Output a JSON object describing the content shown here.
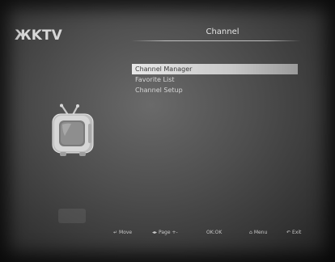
{
  "brand": {
    "logo": "ЖKTV"
  },
  "header": {
    "title": "Channel"
  },
  "menu": {
    "items": [
      {
        "label": "Channel Manager",
        "selected": true
      },
      {
        "label": "Favorite List",
        "selected": false
      },
      {
        "label": "Channel Setup",
        "selected": false
      }
    ]
  },
  "icons": {
    "main": "tv-icon"
  },
  "footer": {
    "hints": [
      {
        "glyph": "↵",
        "label": "Move",
        "icon": "enter-icon"
      },
      {
        "glyph": "◂▸",
        "label": "Page +-",
        "icon": "page-arrows-icon"
      },
      {
        "glyph": "",
        "label": "OK:OK",
        "icon": ""
      },
      {
        "glyph": "⌂",
        "label": "Menu",
        "icon": "home-icon"
      },
      {
        "glyph": "↶",
        "label": "Exit",
        "icon": "back-icon"
      }
    ]
  }
}
